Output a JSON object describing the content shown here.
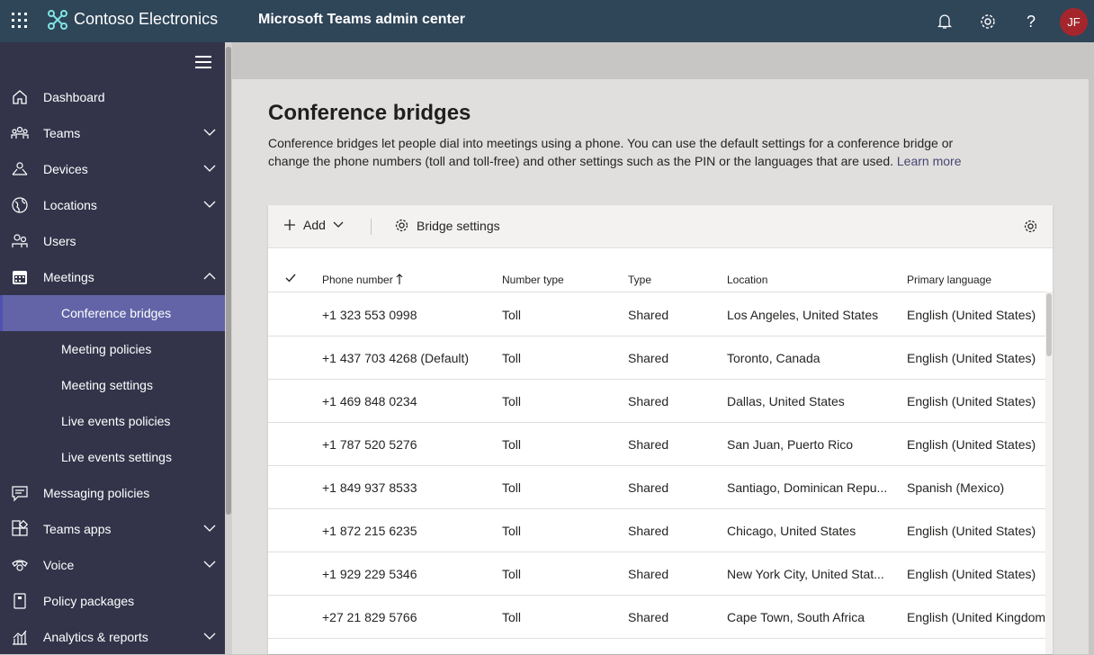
{
  "topbar": {
    "brand": "Contoso Electronics",
    "app_title": "Microsoft Teams admin center",
    "avatar_initials": "JF"
  },
  "sidebar": {
    "items": [
      {
        "label": "Dashboard",
        "icon": "home-icon"
      },
      {
        "label": "Teams",
        "icon": "teams-icon"
      },
      {
        "label": "Devices",
        "icon": "devices-icon"
      },
      {
        "label": "Locations",
        "icon": "globe-icon"
      },
      {
        "label": "Users",
        "icon": "users-icon"
      },
      {
        "label": "Meetings",
        "icon": "calendar-icon"
      },
      {
        "label": "Conference bridges"
      },
      {
        "label": "Meeting policies"
      },
      {
        "label": "Meeting settings"
      },
      {
        "label": "Live events policies"
      },
      {
        "label": "Live events settings"
      },
      {
        "label": "Messaging policies",
        "icon": "message-icon"
      },
      {
        "label": "Teams apps",
        "icon": "apps-icon"
      },
      {
        "label": "Voice",
        "icon": "phone-icon"
      },
      {
        "label": "Policy packages",
        "icon": "package-icon"
      },
      {
        "label": "Analytics & reports",
        "icon": "chart-icon"
      }
    ]
  },
  "page": {
    "title": "Conference bridges",
    "description": "Conference bridges let people dial into meetings using a phone. You can use the default settings for a conference bridge or change the phone numbers (toll and toll-free) and other settings such as the PIN or the languages that are used.",
    "learn_more": "Learn more"
  },
  "toolbar": {
    "add_label": "Add",
    "bridge_settings_label": "Bridge settings"
  },
  "table": {
    "columns": [
      "Phone number",
      "Number type",
      "Type",
      "Location",
      "Primary language"
    ],
    "rows": [
      [
        "+1 323 553 0998",
        "Toll",
        "Shared",
        "Los Angeles, United States",
        "English (United States)"
      ],
      [
        "+1 437 703 4268 (Default)",
        "Toll",
        "Shared",
        "Toronto, Canada",
        "English (United States)"
      ],
      [
        "+1 469 848 0234",
        "Toll",
        "Shared",
        "Dallas, United States",
        "English (United States)"
      ],
      [
        "+1 787 520 5276",
        "Toll",
        "Shared",
        "San Juan, Puerto Rico",
        "English (United States)"
      ],
      [
        "+1 849 937 8533",
        "Toll",
        "Shared",
        "Santiago, Dominican Repu...",
        "Spanish (Mexico)"
      ],
      [
        "+1 872 215 6235",
        "Toll",
        "Shared",
        "Chicago, United States",
        "English (United States)"
      ],
      [
        "+1 929 229 5346",
        "Toll",
        "Shared",
        "New York City, United Stat...",
        "English (United States)"
      ],
      [
        "+27 21 829 5766",
        "Toll",
        "Shared",
        "Cape Town, South Africa",
        "English (United Kingdom"
      ]
    ]
  },
  "colors": {
    "topbar": "#2f4558",
    "sidebar": "#33344a",
    "active_item": "#6264a7",
    "avatar": "#a4262c"
  }
}
